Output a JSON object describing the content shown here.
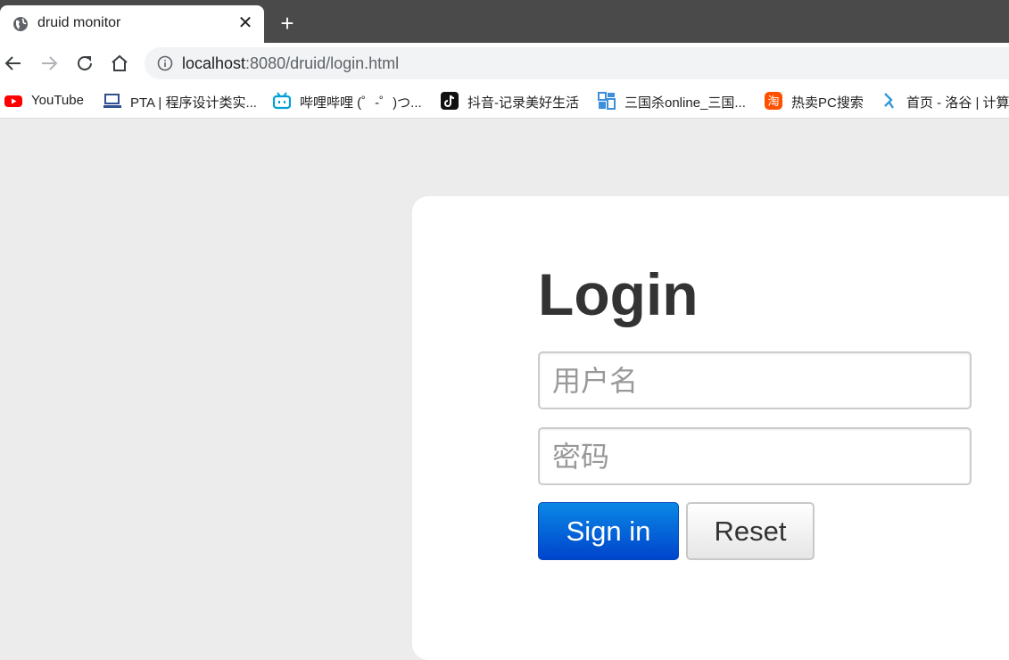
{
  "browser": {
    "tab": {
      "title": "druid monitor",
      "close_glyph": "✕",
      "icon": "globe-icon"
    },
    "new_tab_glyph": "+",
    "toolbar": {
      "back_icon": "back-arrow-icon",
      "forward_icon": "forward-arrow-icon",
      "reload_icon": "reload-icon",
      "home_icon": "home-icon"
    },
    "address_bar": {
      "host": "localhost",
      "rest": ":8080/druid/login.html",
      "icon": "info-icon"
    },
    "bookmarks": [
      {
        "label": "YouTube",
        "icon": "youtube-icon"
      },
      {
        "label": "PTA | 程序设计类实...",
        "icon": "pta-icon"
      },
      {
        "label": "哔哩哔哩 (゜-゜)つ...",
        "icon": "bilibili-icon"
      },
      {
        "label": "抖音-记录美好生活",
        "icon": "douyin-icon"
      },
      {
        "label": "三国杀online_三国...",
        "icon": "sanguosha-icon"
      },
      {
        "label": "热卖PC搜索",
        "icon": "taobao-icon"
      },
      {
        "label": "首页 - 洛谷 | 计算",
        "icon": "luogu-icon"
      }
    ]
  },
  "login": {
    "title": "Login",
    "username_placeholder": "用户名",
    "password_placeholder": "密码",
    "sign_in_label": "Sign in",
    "reset_label": "Reset"
  },
  "colors": {
    "tabstrip": "#4a4a4a",
    "page_background": "#ececec",
    "primary_button": "#0055cc"
  }
}
